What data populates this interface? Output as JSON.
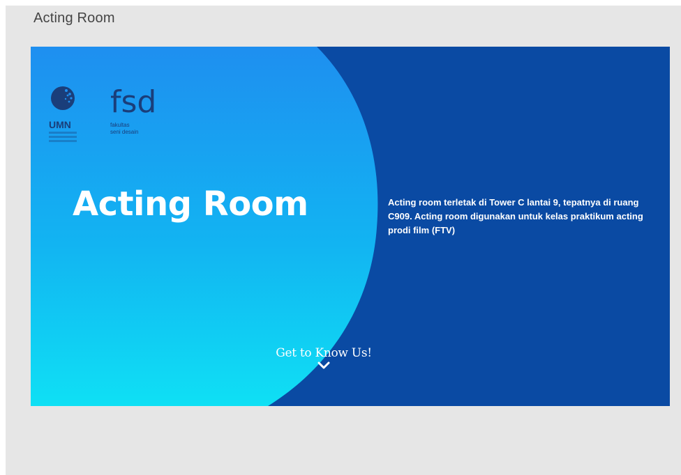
{
  "window": {
    "title": "Acting Room"
  },
  "slide": {
    "logos": {
      "umn_text": "UMN",
      "fsd_text": "fsd",
      "fsd_caption_line1": "fakultas",
      "fsd_caption_line2": "seni desain"
    },
    "headline": "Acting Room",
    "description": "Acting room terletak di Tower C lantai 9, tepatnya di ruang C909. Acting room digunakan untuk kelas praktikum acting prodi film (FTV)",
    "cta_label": "Get to Know Us!",
    "cta_icon": "chevron-down-icon"
  },
  "colors": {
    "background_navy": "#0a4aa3",
    "gradient_top": "#1e8ff0",
    "gradient_bottom": "#0fe0f4",
    "text_white": "#ffffff",
    "logo_navy": "#1a3e7a",
    "frame_gray": "#e6e6e6"
  }
}
